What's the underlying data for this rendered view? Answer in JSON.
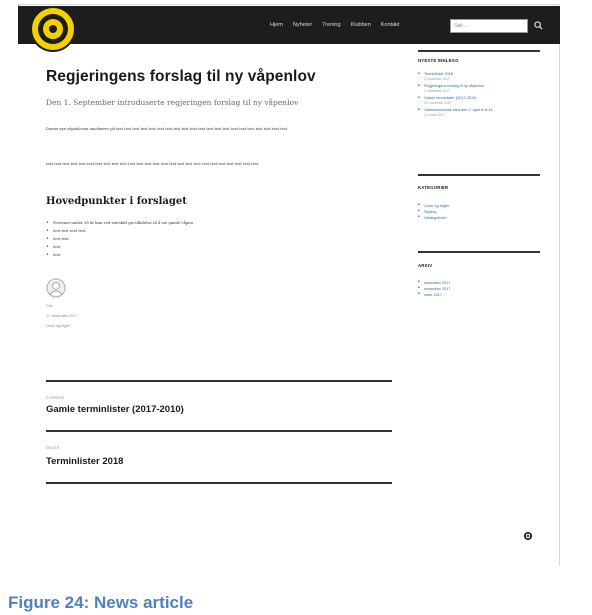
{
  "nav": {
    "items": [
      "Hjem",
      "Nyheter",
      "Trening",
      "Klubben",
      "Kontakt"
    ],
    "search_placeholder": "Søk ..."
  },
  "article": {
    "title": "Regjeringens forslag til ny våpenlov",
    "lead": "Den 1. September introduserte regjeringen forslag til ny våpenlov",
    "para1": "Denne nye våpenloven innebærer på test test test test test test test test test test test test test test test test test test test test test",
    "para2": "test test test test test test test test test test test test test test test test test test test test test test test test test test",
    "heading": "Hovedpunkter i forslaget",
    "bullets": [
      "Personer under 18 år kan ved særskilt gis tillatelse til å eie gamle våpen",
      "test test test test",
      "test test",
      "test",
      "test"
    ],
    "author": "Gris",
    "date": "21. desember 2017",
    "category": "Lover og regler"
  },
  "post_nav": {
    "prev_kicker": "FORRIGE",
    "prev_title": "Gamle terminlister (2017-2010)",
    "next_kicker": "NESTE",
    "next_title": "Terminlister 2018"
  },
  "sidebar": {
    "recent_heading": "NYESTE INNLEGG",
    "recent": [
      {
        "title": "Terminlister 2018",
        "date": "3. desember 2017"
      },
      {
        "title": "Regjeringens forslag til ny våpenlov",
        "date": "1. desember 2017"
      },
      {
        "title": "Gamle terminlister (2017-2010)",
        "date": "15. november 2017"
      },
      {
        "title": "Julekonkurranse sted den 2. april til kl 11",
        "date": "10. mars 2017"
      }
    ],
    "categories_heading": "KATEGORIER",
    "categories": [
      "Lover og regler",
      "Skyting",
      "Ukategorisert"
    ],
    "archive_heading": "ARKIV",
    "archive": [
      "desember 2017",
      "november 2017",
      "mars 2017"
    ]
  },
  "caption": "Figure 24: News article",
  "colors": {
    "navbar": "#1d1d1d",
    "logo": "#f5d000",
    "link": "#2b6cb0",
    "caption": "#4f81bd"
  }
}
